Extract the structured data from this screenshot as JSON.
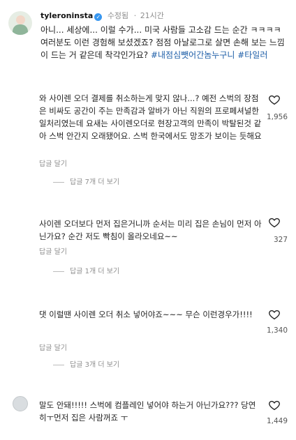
{
  "post": {
    "username": "tyleroninsta",
    "edited": "수정됨",
    "dot": "·",
    "time": "21시간",
    "caption_text": "아니... 세상에... 이럴 수가... 미국 사람들 고소감 드는 순간 ㅋㅋㅋㅋ 여러분도 이런 경험해 보셨겠죠? 점점 아날로그로 살면 손해 보는 느낌이 드는 거 같은데 착각인가요?",
    "hashtags": "#내점심뺏어간놈누구니 #타일러"
  },
  "comments": [
    {
      "text": "와 사이렌 오더 결제를 취소하는게 맞지 않나...? 예전 스벅의 장점은 비싸도 공간이 주는 만족감과 알바가 아닌 직원의 프로페셔널한 일처리였는데 요새는 사이렌오더로 현장고객의 만족이 박탈된것 같아 스벅 안간지 오래됐어요. 스벅 한국에서도 망조가 보이는 듯해요",
      "likes": "1,956",
      "reply_label": "답글 달기",
      "more_replies": "답글 7개 더 보기"
    },
    {
      "text": "사이렌 오더보다 먼저 집은거니까 순서는 미리 집은 손님이 먼저 아닌가요? 순간 저도 빡침이 올라오네요~~",
      "likes": "327",
      "reply_label": "답글 달기",
      "more_replies": "답글 1개 더 보기"
    },
    {
      "text": "댓 이럴땐 사이렌 오더 취소 넣어야죠~~~ 무슨 이런경우가!!!!",
      "likes": "1,340",
      "reply_label": "답글 달기",
      "more_replies": "답글 3개 더 보기"
    },
    {
      "text": "말도 안돼!!!!! 스벅에 컴플레인 넣어야 하는거 아닌가요??? 당연히ㅜ먼저 집은 사람꺼죠 ㅜ",
      "likes": "1,449"
    }
  ]
}
